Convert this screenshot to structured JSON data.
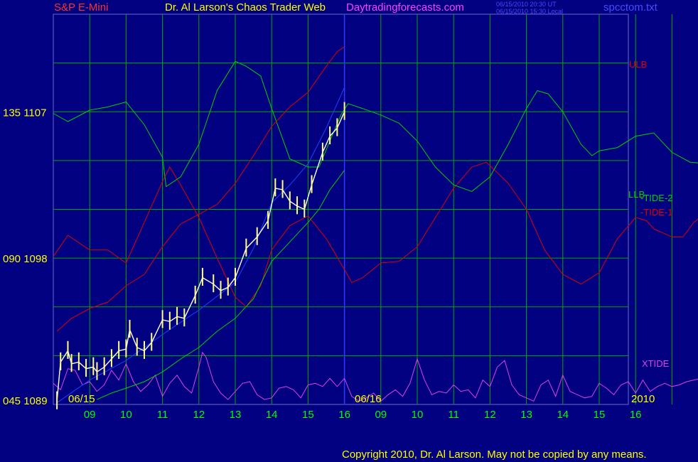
{
  "header": {
    "instrument": "S&P E-Mini",
    "title": "Dr. Al Larson's Chaos Trader Web",
    "site": "Daytradingforecasts.com",
    "timestamp_ut": "06/15/2010 20:30 UT",
    "timestamp_local": "06/15/2010 15:30 Local",
    "filename": "spcctom.txt"
  },
  "footer": {
    "copyright": "Copyright 2010, Dr. Al Larson.  May not be copied by any means."
  },
  "colors": {
    "background": "#000080",
    "grid": "#00a800",
    "frame": "#6a6ad0",
    "ulb": "#e00000",
    "llb": "#00d000",
    "tide1": "#e00000",
    "tide2": "#00d000",
    "xtide": "#e040e0",
    "channel_blue": "#2040ff",
    "price": "#ffffff",
    "date_text": "#ffff00",
    "hour_text": "#00ff00",
    "y_text": "#ffff00"
  },
  "chart_data": {
    "type": "line",
    "title": "S&P E-Mini",
    "x_dates": [
      "06/15",
      "06/16"
    ],
    "year": "2010",
    "x_hour_ticks": [
      "09",
      "10",
      "11",
      "12",
      "13",
      "14",
      "15",
      "16",
      "09",
      "10",
      "11",
      "12",
      "13",
      "14",
      "15",
      "16"
    ],
    "y_tick_labels": [
      {
        "label": "135 1107",
        "value": 1107
      },
      {
        "label": "090 1098",
        "value": 1098
      },
      {
        "label": "045 1089",
        "value": 1089
      }
    ],
    "ylim": [
      1089,
      1113
    ],
    "now_marker_hour": 16,
    "series": [
      {
        "name": "ULB",
        "values": [
          [
            8.1,
            1093.5
          ],
          [
            8.5,
            1094.3
          ],
          [
            9,
            1094.9
          ],
          [
            9.5,
            1095.3
          ],
          [
            10,
            1096.3
          ],
          [
            10.5,
            1097
          ],
          [
            11,
            1098.7
          ],
          [
            11.5,
            1100.1
          ],
          [
            12,
            1100.7
          ],
          [
            12.5,
            1101.3
          ],
          [
            13,
            1102.6
          ],
          [
            13.5,
            1104.3
          ],
          [
            14,
            1106.1
          ],
          [
            14.5,
            1107.3
          ],
          [
            15,
            1108.2
          ],
          [
            15.5,
            1109.8
          ],
          [
            15.8,
            1110.7
          ],
          [
            16,
            1111
          ]
        ]
      },
      {
        "name": "LLB",
        "values": [
          [
            9.2,
            1089.3
          ],
          [
            9.6,
            1089.7
          ],
          [
            10,
            1090
          ],
          [
            10.5,
            1090.4
          ],
          [
            11,
            1091
          ],
          [
            11.5,
            1091.8
          ],
          [
            12,
            1092.5
          ],
          [
            12.5,
            1093.5
          ],
          [
            13,
            1094.3
          ],
          [
            13.5,
            1095.5
          ],
          [
            14,
            1097.8
          ],
          [
            14.5,
            1099
          ],
          [
            15,
            1100.2
          ],
          [
            15.3,
            1101
          ],
          [
            15.6,
            1102.2
          ],
          [
            16,
            1103.4
          ]
        ]
      },
      {
        "name": "channel",
        "values": [
          [
            8.1,
            1089.1
          ],
          [
            9,
            1090.5
          ],
          [
            10,
            1091.7
          ],
          [
            11,
            1093.3
          ],
          [
            12,
            1094.8
          ],
          [
            13,
            1096.5
          ],
          [
            13.5,
            1098.6
          ],
          [
            14,
            1101.4
          ],
          [
            14.5,
            1102.5
          ],
          [
            15,
            1103.8
          ],
          [
            15.5,
            1106
          ],
          [
            16,
            1108.5
          ]
        ]
      },
      {
        "name": "TIDE-1",
        "values": [
          [
            8,
            1098.1
          ],
          [
            8.4,
            1099.4
          ],
          [
            9,
            1098.5
          ],
          [
            9.5,
            1098.5
          ],
          [
            10,
            1097.7
          ],
          [
            10.5,
            1100.2
          ],
          [
            11,
            1102.7
          ],
          [
            11.2,
            1103.6
          ],
          [
            11.5,
            1102.5
          ],
          [
            12,
            1100.5
          ],
          [
            12.5,
            1098
          ],
          [
            13,
            1095.6
          ],
          [
            13.3,
            1095
          ],
          [
            13.7,
            1096.3
          ],
          [
            14,
            1098.5
          ],
          [
            14.5,
            1100
          ],
          [
            15,
            1100.6
          ],
          [
            15.5,
            1099.2
          ],
          [
            16,
            1097.3
          ],
          [
            16.2,
            1096.5
          ],
          [
            16.5,
            1096.8
          ],
          [
            17,
            1097.7
          ],
          [
            17.5,
            1097.8
          ],
          [
            18,
            1098.7
          ],
          [
            18.5,
            1100.5
          ],
          [
            19,
            1102.3
          ],
          [
            19.5,
            1103.6
          ],
          [
            19.9,
            1103.9
          ],
          [
            20.5,
            1102.6
          ],
          [
            21,
            1101
          ],
          [
            21.5,
            1098.5
          ],
          [
            22,
            1097
          ],
          [
            22.5,
            1096.4
          ],
          [
            23,
            1097.1
          ],
          [
            23.5,
            1099.2
          ],
          [
            24,
            1100.5
          ],
          [
            24.3,
            1100.3
          ],
          [
            24.5,
            1099.8
          ],
          [
            25,
            1099.3
          ],
          [
            25.3,
            1099.3
          ],
          [
            25.6,
            1100.2
          ],
          [
            26,
            1100.9
          ]
        ]
      },
      {
        "name": "TIDE-2",
        "values": [
          [
            8,
            1106.9
          ],
          [
            8.4,
            1106.4
          ],
          [
            9,
            1107.1
          ],
          [
            9.5,
            1107.3
          ],
          [
            10,
            1107.6
          ],
          [
            10.5,
            1106.2
          ],
          [
            11,
            1104.2
          ],
          [
            11.1,
            1102.4
          ],
          [
            11.5,
            1103
          ],
          [
            12,
            1105
          ],
          [
            12.5,
            1108.3
          ],
          [
            13,
            1110.1
          ],
          [
            13.3,
            1109.8
          ],
          [
            13.7,
            1109.2
          ],
          [
            14,
            1107.2
          ],
          [
            14.5,
            1104.1
          ],
          [
            15,
            1103.6
          ],
          [
            15.3,
            1103.6
          ],
          [
            15.6,
            1105.2
          ],
          [
            15.9,
            1106.8
          ],
          [
            16.1,
            1107.5
          ],
          [
            16.5,
            1107.2
          ],
          [
            17,
            1106.8
          ],
          [
            17.5,
            1106.3
          ],
          [
            18,
            1105.2
          ],
          [
            18.5,
            1103.6
          ],
          [
            19,
            1102.5
          ],
          [
            19.5,
            1102.1
          ],
          [
            20,
            1103
          ],
          [
            20.5,
            1105
          ],
          [
            21,
            1107.2
          ],
          [
            21.3,
            1108.3
          ],
          [
            21.6,
            1108.1
          ],
          [
            22,
            1107
          ],
          [
            22.5,
            1105
          ],
          [
            22.8,
            1104.3
          ],
          [
            23,
            1104.6
          ],
          [
            23.5,
            1104.8
          ],
          [
            24,
            1105.5
          ],
          [
            24.5,
            1105.7
          ],
          [
            25,
            1104.5
          ],
          [
            25.5,
            1103.9
          ],
          [
            26,
            1103.8
          ]
        ]
      },
      {
        "name": "XTIDE",
        "values": [
          [
            8,
            1090.3
          ],
          [
            8.2,
            1089.9
          ],
          [
            8.4,
            1091.2
          ],
          [
            8.6,
            1091.1
          ],
          [
            8.8,
            1090.2
          ],
          [
            9,
            1090.4
          ],
          [
            9.2,
            1089.8
          ],
          [
            9.4,
            1090.2
          ],
          [
            9.6,
            1091.1
          ],
          [
            9.8,
            1090.5
          ],
          [
            10,
            1091.5
          ],
          [
            10.2,
            1090.4
          ],
          [
            10.4,
            1089.8
          ],
          [
            10.6,
            1090.2
          ],
          [
            10.8,
            1090.8
          ],
          [
            11,
            1089.5
          ],
          [
            11.2,
            1090.3
          ],
          [
            11.4,
            1090.8
          ],
          [
            11.6,
            1090.1
          ],
          [
            11.8,
            1089.7
          ],
          [
            12,
            1091.3
          ],
          [
            12.1,
            1092.2
          ],
          [
            12.2,
            1091.9
          ],
          [
            12.4,
            1090.4
          ],
          [
            12.6,
            1089.7
          ],
          [
            12.8,
            1089.3
          ],
          [
            13,
            1089.8
          ],
          [
            13.2,
            1090.3
          ],
          [
            13.4,
            1090.4
          ],
          [
            13.6,
            1089.6
          ],
          [
            13.8,
            1089.3
          ],
          [
            14,
            1089.4
          ],
          [
            14.2,
            1090
          ],
          [
            14.4,
            1090.1
          ],
          [
            14.6,
            1089.9
          ],
          [
            14.8,
            1089.4
          ],
          [
            15,
            1090.2
          ],
          [
            15.2,
            1090.3
          ],
          [
            15.4,
            1090.1
          ],
          [
            15.6,
            1090.6
          ],
          [
            15.8,
            1090.1
          ],
          [
            16,
            1090.6
          ],
          [
            16.2,
            1089.5
          ],
          [
            16.4,
            1089.2
          ],
          [
            16.6,
            1089.4
          ],
          [
            16.8,
            1089.7
          ],
          [
            17,
            1089.2
          ],
          [
            17.2,
            1089.6
          ],
          [
            17.4,
            1089.9
          ],
          [
            17.6,
            1089.5
          ],
          [
            17.8,
            1090.3
          ],
          [
            18,
            1091.8
          ],
          [
            18.2,
            1090.5
          ],
          [
            18.4,
            1089.6
          ],
          [
            18.6,
            1089.8
          ],
          [
            18.8,
            1089.7
          ],
          [
            19,
            1090.2
          ],
          [
            19.2,
            1089.8
          ],
          [
            19.4,
            1089.9
          ],
          [
            19.6,
            1089.4
          ],
          [
            19.8,
            1090.5
          ],
          [
            20,
            1090.1
          ],
          [
            20.2,
            1091.3
          ],
          [
            20.4,
            1091.7
          ],
          [
            20.6,
            1090.2
          ],
          [
            20.8,
            1089.6
          ],
          [
            21,
            1089.4
          ],
          [
            21.2,
            1089.2
          ],
          [
            21.4,
            1090.2
          ],
          [
            21.6,
            1090.5
          ],
          [
            21.8,
            1089.5
          ],
          [
            22,
            1090.8
          ],
          [
            22.2,
            1089.8
          ],
          [
            22.4,
            1089.6
          ],
          [
            22.6,
            1089.4
          ],
          [
            22.8,
            1089.5
          ],
          [
            23,
            1090.3
          ],
          [
            23.2,
            1090
          ],
          [
            23.4,
            1089.6
          ],
          [
            23.6,
            1090.2
          ],
          [
            23.8,
            1090.4
          ],
          [
            24,
            1089.7
          ],
          [
            24.2,
            1090.5
          ],
          [
            24.4,
            1089.8
          ],
          [
            24.6,
            1090.1
          ],
          [
            24.8,
            1090.3
          ],
          [
            25,
            1090.1
          ],
          [
            25.2,
            1090.2
          ],
          [
            25.4,
            1090.4
          ],
          [
            25.6,
            1090.5
          ],
          [
            25.8,
            1090.6
          ],
          [
            26,
            1090.3
          ]
        ]
      },
      {
        "name": "Price",
        "values": [
          [
            8.1,
            1089.2
          ],
          [
            8.2,
            1091.6
          ],
          [
            8.4,
            1092.3
          ],
          [
            8.5,
            1091.5
          ],
          [
            8.7,
            1091.6
          ],
          [
            8.9,
            1091.2
          ],
          [
            9.1,
            1091.3
          ],
          [
            9.2,
            1091
          ],
          [
            9.4,
            1091.3
          ],
          [
            9.6,
            1091.8
          ],
          [
            9.8,
            1092.3
          ],
          [
            10,
            1092.4
          ],
          [
            10.1,
            1093.6
          ],
          [
            10.3,
            1092.5
          ],
          [
            10.5,
            1092.3
          ],
          [
            10.7,
            1092.8
          ],
          [
            11,
            1094.2
          ],
          [
            11.2,
            1094.1
          ],
          [
            11.4,
            1094.4
          ],
          [
            11.6,
            1094.3
          ],
          [
            11.9,
            1095.7
          ],
          [
            12.1,
            1096.8
          ],
          [
            12.4,
            1096.4
          ],
          [
            12.6,
            1096
          ],
          [
            12.8,
            1096.2
          ],
          [
            13,
            1096.8
          ],
          [
            13.3,
            1098.6
          ],
          [
            13.6,
            1099.3
          ],
          [
            13.9,
            1100.3
          ],
          [
            14.1,
            1102.3
          ],
          [
            14.3,
            1102.2
          ],
          [
            14.5,
            1101.5
          ],
          [
            14.7,
            1101.2
          ],
          [
            14.9,
            1101
          ],
          [
            15.1,
            1102.5
          ],
          [
            15.4,
            1104.5
          ],
          [
            15.6,
            1105.5
          ],
          [
            15.8,
            1106
          ],
          [
            16,
            1107
          ]
        ]
      }
    ],
    "labels": [
      {
        "text": "ULB",
        "series": "ULB"
      },
      {
        "text": "LLB",
        "series": "LLB"
      },
      {
        "text": "-TIDE-2",
        "series": "TIDE-2"
      },
      {
        "text": "-TIDE-1",
        "series": "TIDE-1"
      },
      {
        "text": "XTIDE",
        "series": "XTIDE"
      }
    ]
  }
}
